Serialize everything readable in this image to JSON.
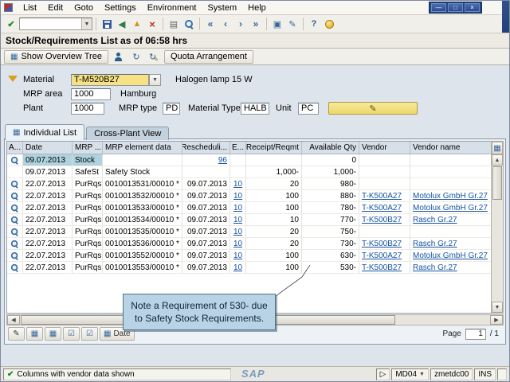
{
  "menubar": {
    "items": [
      "List",
      "Edit",
      "Goto",
      "Settings",
      "Environment",
      "System",
      "Help"
    ]
  },
  "toolbar": {
    "command_value": ""
  },
  "header": {
    "title": "Stock/Requirements List as of 06:58 hrs"
  },
  "app_toolbar": {
    "overview": "Show Overview Tree",
    "quota": "Quota Arrangement"
  },
  "form": {
    "material_label": "Material",
    "material_value": "T-M520B27",
    "material_desc": "Halogen lamp 15 W",
    "mrp_area_label": "MRP area",
    "mrp_area_value": "1000",
    "mrp_area_desc": "Hamburg",
    "plant_label": "Plant",
    "plant_value": "1000",
    "mrp_type_label": "MRP type",
    "mrp_type_value": "PD",
    "material_type_label": "Material Type",
    "material_type_value": "HALB",
    "unit_label": "Unit",
    "unit_value": "PC"
  },
  "tabs": {
    "individual": "Individual List",
    "cross_plant": "Cross-Plant View"
  },
  "table": {
    "columns": [
      "A...",
      "Date",
      "MRP ...",
      "MRP element data",
      "Rescheduli...",
      "E...",
      "Receipt/Reqmt",
      "Available Qty",
      "Vendor",
      "Vendor name"
    ],
    "rows": [
      {
        "date": "09.07.2013",
        "mrp": "Stock",
        "element": "",
        "resched": "96",
        "e": "",
        "receipt": "",
        "avail": "0",
        "vendor": "",
        "vendor_name": ""
      },
      {
        "date": "09.07.2013",
        "mrp": "SafeSt",
        "element": "Safety Stock",
        "resched": "",
        "e": "",
        "receipt": "1,000-",
        "avail": "1,000-",
        "vendor": "",
        "vendor_name": ""
      },
      {
        "date": "22.07.2013",
        "mrp": "PurRqs",
        "element": "0010013531/00010 *",
        "resched": "09.07.2013",
        "e": "10",
        "receipt": "20",
        "avail": "980-",
        "vendor": "",
        "vendor_name": ""
      },
      {
        "date": "22.07.2013",
        "mrp": "PurRqs",
        "element": "0010013532/00010 *",
        "resched": "09.07.2013",
        "e": "10",
        "receipt": "100",
        "avail": "880-",
        "vendor": "T-K500A27",
        "vendor_name": "Motolux GmbH Gr.27"
      },
      {
        "date": "22.07.2013",
        "mrp": "PurRqs",
        "element": "0010013533/00010 *",
        "resched": "09.07.2013",
        "e": "10",
        "receipt": "100",
        "avail": "780-",
        "vendor": "T-K500A27",
        "vendor_name": "Motolux GmbH Gr.27"
      },
      {
        "date": "22.07.2013",
        "mrp": "PurRqs",
        "element": "0010013534/00010 *",
        "resched": "09.07.2013",
        "e": "10",
        "receipt": "10",
        "avail": "770-",
        "vendor": "T-K500B27",
        "vendor_name": "Rasch Gr.27"
      },
      {
        "date": "22.07.2013",
        "mrp": "PurRqs",
        "element": "0010013535/00010 *",
        "resched": "09.07.2013",
        "e": "10",
        "receipt": "20",
        "avail": "750-",
        "vendor": "",
        "vendor_name": ""
      },
      {
        "date": "22.07.2013",
        "mrp": "PurRqs",
        "element": "0010013536/00010 *",
        "resched": "09.07.2013",
        "e": "10",
        "receipt": "20",
        "avail": "730-",
        "vendor": "T-K500B27",
        "vendor_name": "Rasch Gr.27"
      },
      {
        "date": "22.07.2013",
        "mrp": "PurRqs",
        "element": "0010013552/00010 *",
        "resched": "09.07.2013",
        "e": "10",
        "receipt": "100",
        "avail": "630-",
        "vendor": "T-K500A27",
        "vendor_name": "Motolux GmbH Gr.27"
      },
      {
        "date": "22.07.2013",
        "mrp": "PurRqs",
        "element": "0010013553/00010 *",
        "resched": "09.07.2013",
        "e": "10",
        "receipt": "100",
        "avail": "530-",
        "vendor": "T-K500B27",
        "vendor_name": "Rasch Gr.27"
      }
    ]
  },
  "footer": {
    "date_button": "Date",
    "page_label": "Page",
    "page_current": "1",
    "page_total": "/  1"
  },
  "callout": {
    "text": "Note a Requirement of 530- due to Safety Stock Requirements."
  },
  "statusbar": {
    "message": "Columns with vendor data shown",
    "sap_logo": "SAP",
    "transaction": "MD04",
    "server": "zmetdc00",
    "mode": "INS"
  },
  "colors": {
    "accent_yellow": "#f3e27c",
    "link_blue": "#1553a3",
    "highlight_teal": "#aed2de",
    "callout_blue": "#b9d3e6"
  },
  "icons": {
    "enter": "✔",
    "dropdown": "▼",
    "back": "◀",
    "exit": "▲",
    "cancel": "×",
    "print": "▤",
    "first": "«",
    "prev": "‹",
    "next": "›",
    "last": "»",
    "new_session": "▣",
    "shortcut": "✎",
    "help": "?",
    "refresh": "↻",
    "grid": "▦",
    "check_on": "☑",
    "pencil": "✎",
    "up": "▲",
    "down": "▼",
    "left": "◀",
    "right": "▶",
    "win_min": "—",
    "win_max": "□",
    "win_close": "×",
    "play": "▷"
  }
}
